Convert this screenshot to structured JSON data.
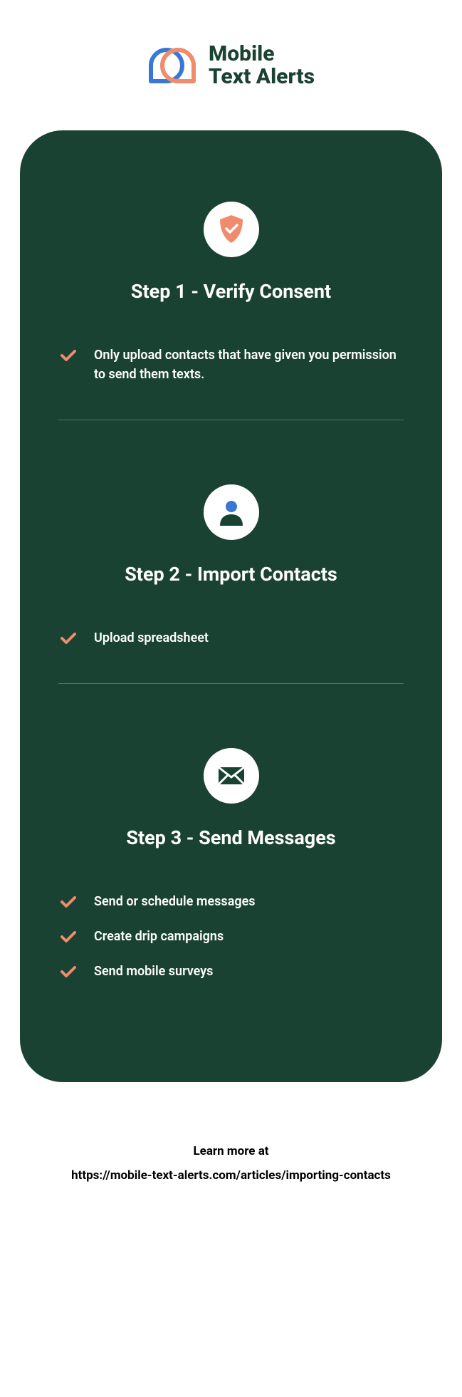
{
  "logo": {
    "line1": "Mobile",
    "line2": "Text Alerts"
  },
  "steps": [
    {
      "title": "Step 1 - Verify Consent",
      "bullets": [
        "Only upload contacts that have given you permission to send them texts."
      ]
    },
    {
      "title": "Step 2 - Import Contacts",
      "bullets": [
        "Upload spreadsheet"
      ]
    },
    {
      "title": "Step 3 - Send Messages",
      "bullets": [
        "Send or schedule messages",
        "Create drip campaigns",
        "Send mobile surveys"
      ]
    }
  ],
  "footer": {
    "line1": "Learn more at",
    "line2": "https://mobile-text-alerts.com/articles/importing-contacts"
  }
}
